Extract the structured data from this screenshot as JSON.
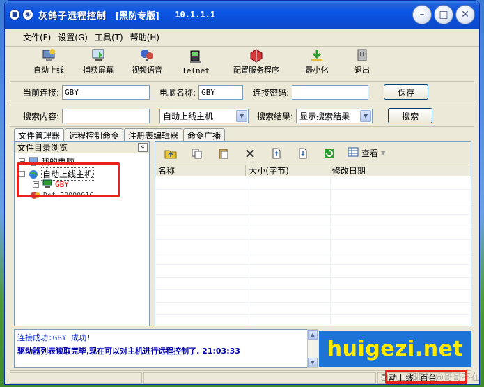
{
  "window": {
    "title": "灰鸽子远程控制",
    "badge": "[黑防专版]",
    "version": "10.1.1.1"
  },
  "menu": [
    "文件(F)",
    "设置(G)",
    "工具(T)",
    "帮助(H)"
  ],
  "toolbar": [
    {
      "label": "自动上线",
      "icon": "auto-online-icon"
    },
    {
      "label": "捕获屏幕",
      "icon": "capture-screen-icon"
    },
    {
      "label": "视频语音",
      "icon": "video-voice-icon"
    },
    {
      "label": "Telnet",
      "icon": "telnet-icon"
    },
    {
      "label": "配置服务程序",
      "icon": "config-service-icon"
    },
    {
      "label": "最小化",
      "icon": "minimize-icon"
    },
    {
      "label": "退出",
      "icon": "exit-icon"
    }
  ],
  "connection": {
    "current_label": "当前连接:",
    "current_value": "GBY",
    "computer_label": "电脑名称:",
    "computer_value": "GBY",
    "password_label": "连接密码:",
    "password_value": "",
    "save_label": "保存"
  },
  "search": {
    "content_label": "搜索内容:",
    "content_value": "",
    "scope_value": "自动上线主机",
    "result_label": "搜索结果:",
    "result_value": "显示搜索结果",
    "search_label": "搜索"
  },
  "tabs": [
    "文件管理器",
    "远程控制命令",
    "注册表编辑器",
    "命令广播"
  ],
  "tree": {
    "header": "文件目录浏览",
    "nodes": {
      "my_computer": "我的电脑",
      "auto_online": "自动上线主机",
      "gby": "GBY",
      "extra": "Dst_2000001C"
    }
  },
  "filelist": {
    "headers": [
      "名称",
      "大小(字节)",
      "修改日期"
    ],
    "view_label": "查看"
  },
  "log": {
    "line1": "连接成功:GBY 成功!",
    "line2": "驱动器列表读取完毕,现在可以对主机进行远程控制了. 21:03:33"
  },
  "banner": "huigezi.net",
  "status": {
    "mode": "自动上线",
    "cell": "百台"
  },
  "watermark": "CSDN @哥哥不在",
  "colors": {
    "title_blue": "#0b55e5",
    "highlight_red": "#e8221b",
    "banner_blue": "#1e73d6",
    "banner_yellow": "#ffea00",
    "log_blue": "#0022cc"
  }
}
